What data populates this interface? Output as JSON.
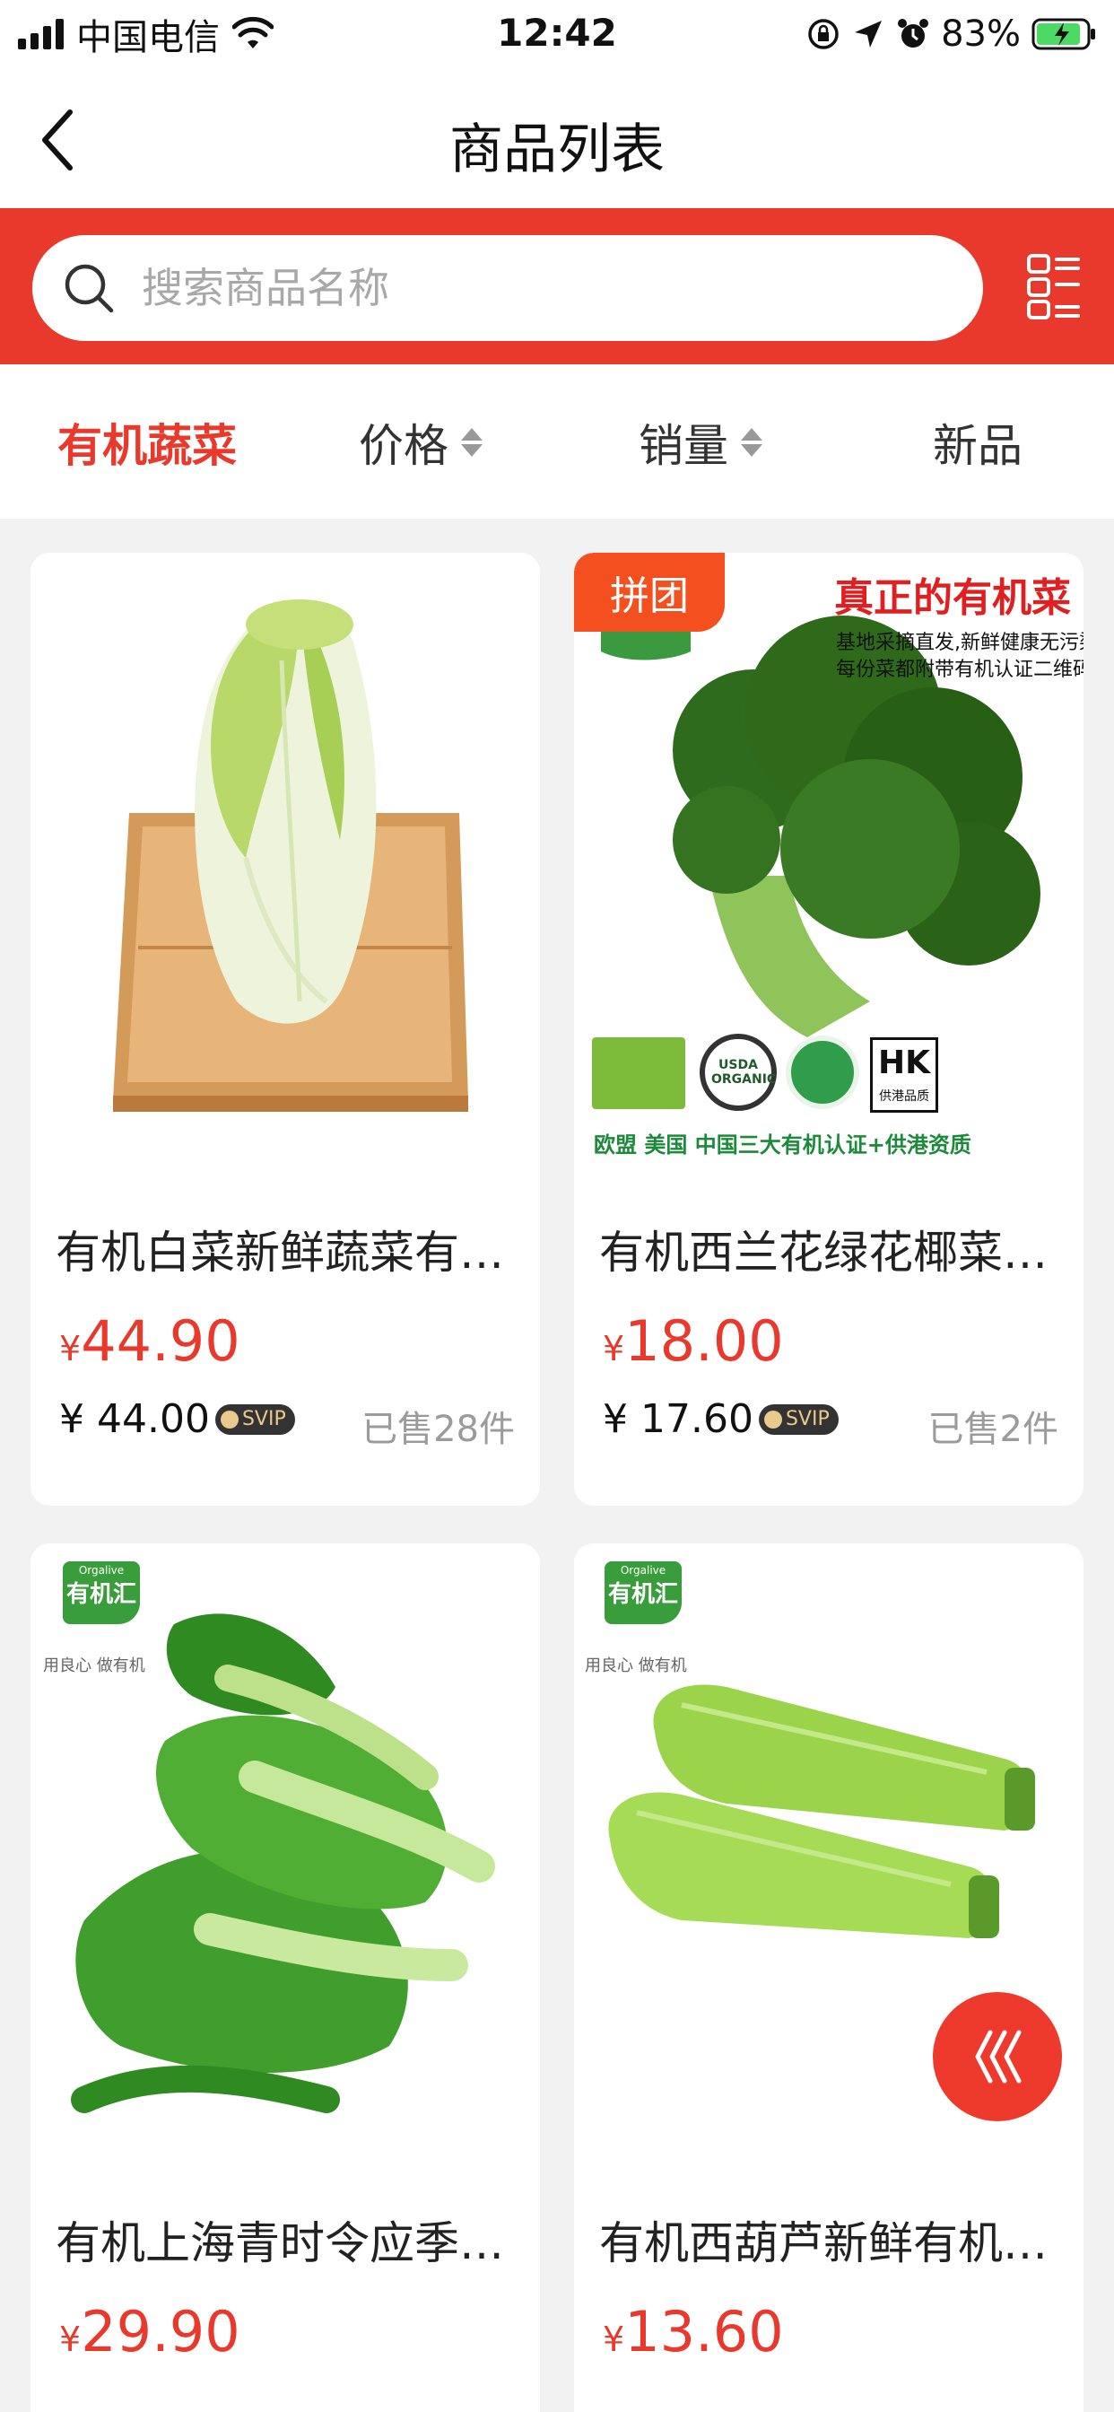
{
  "status_bar": {
    "carrier": "中国电信",
    "time": "12:42",
    "battery_pct": "83%"
  },
  "nav": {
    "title": "商品列表"
  },
  "search": {
    "placeholder": "搜索商品名称"
  },
  "filters": {
    "tabs": [
      {
        "label": "有机蔬菜",
        "active": true
      },
      {
        "label": "价格",
        "sortable": true
      },
      {
        "label": "销量",
        "sortable": true
      },
      {
        "label": "新品"
      }
    ]
  },
  "products": [
    {
      "name": "有机白菜新鲜蔬菜有…",
      "currency": "¥",
      "price": "44.90",
      "vip_price": "¥ 44.00",
      "vip_label": "SVIP",
      "sold": "已售28件",
      "image": "napa-cabbage-image"
    },
    {
      "name": "有机西兰花绿花椰菜…",
      "currency": "¥",
      "price": "18.00",
      "vip_price": "¥ 17.60",
      "vip_label": "SVIP",
      "sold": "已售2件",
      "tag": "拼团",
      "banner_title": "真正的有机菜",
      "banner_line1": "基地采摘直发,新鲜健康无污染",
      "banner_line2": "每份菜都附带有机认证二维码",
      "cert_text": "欧盟 美国 中国三大有机认证+供港资质",
      "usda_text": "USDA ORGANIC",
      "hk_text": "HK",
      "hk_sub": "供港品质",
      "image": "broccoli-image"
    },
    {
      "name": "有机上海青时令应季…",
      "currency": "¥",
      "price": "29.90",
      "brand_en": "Orgalive",
      "brand_cn": "有机汇",
      "slogan": "用良心 做有机",
      "image": "bok-choy-image"
    },
    {
      "name": "有机西葫芦新鲜有机…",
      "currency": "¥",
      "price": "13.60",
      "brand_en": "Orgalive",
      "brand_cn": "有机汇",
      "slogan": "用良心 做有机",
      "image": "zucchini-image"
    }
  ],
  "colors": {
    "accent": "#e8392c",
    "tag": "#f4501f"
  }
}
